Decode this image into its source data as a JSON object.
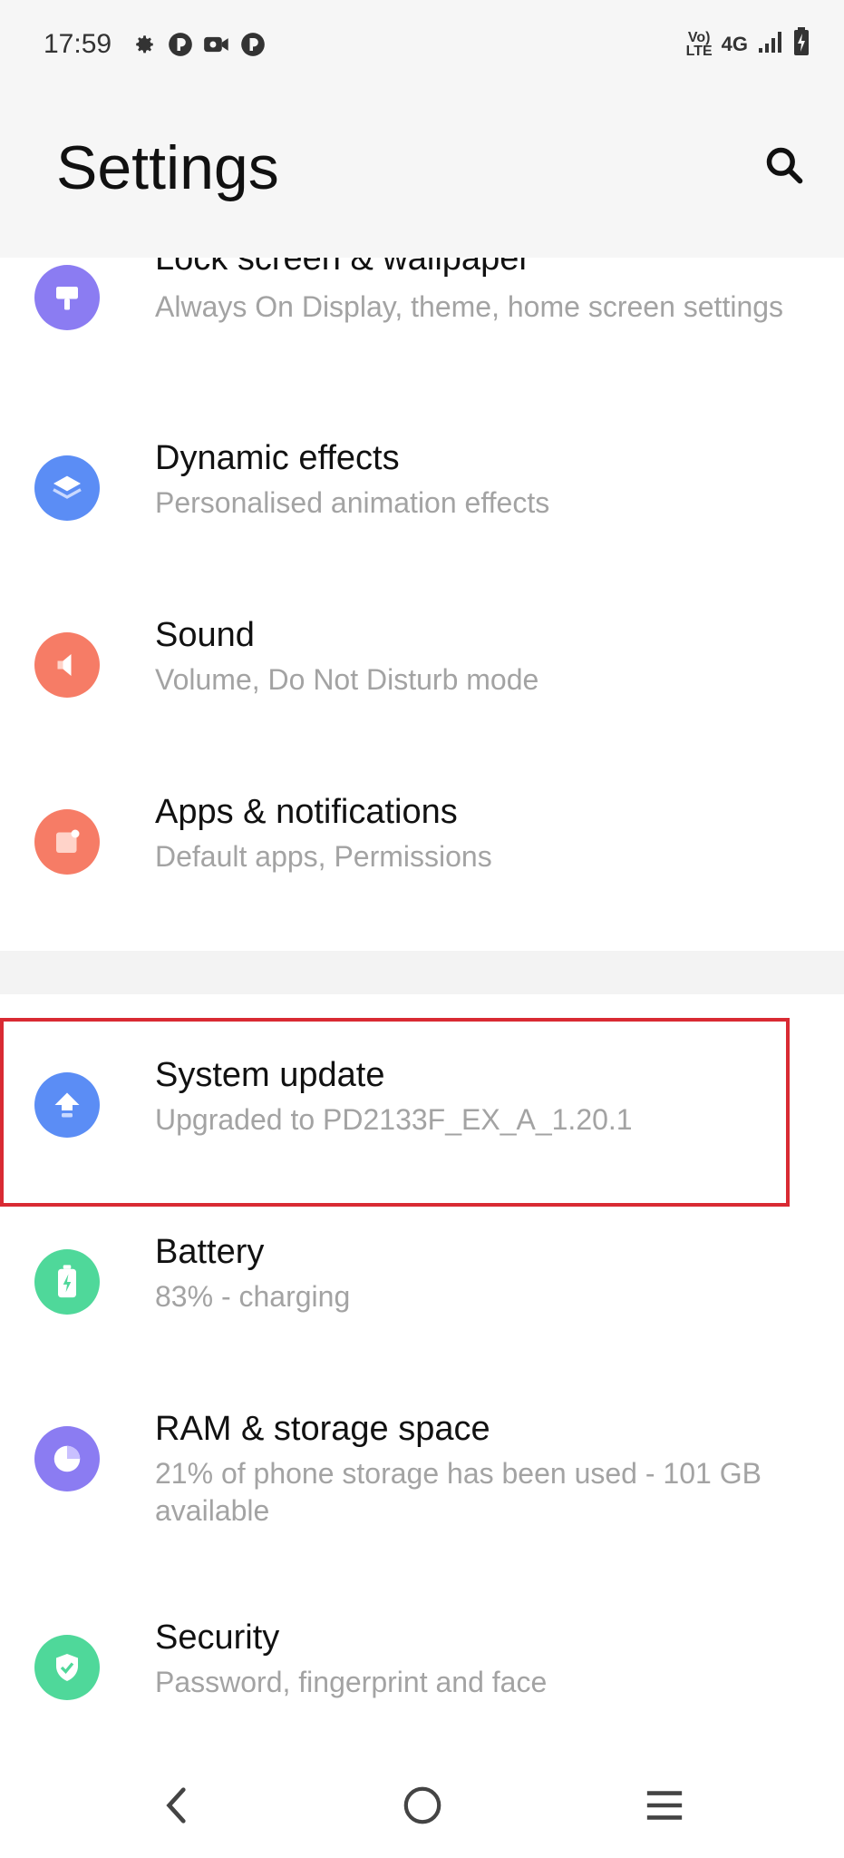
{
  "status_bar": {
    "time": "17:59",
    "left_icons": [
      "gear-icon",
      "app-icon",
      "video-icon",
      "app-icon"
    ],
    "lte_top": "Vo)",
    "lte_bottom": "LTE",
    "network": "4G",
    "right_icons": [
      "signal-icon",
      "battery-charging-icon"
    ]
  },
  "header": {
    "title": "Settings",
    "search_icon": "search-icon"
  },
  "settings": {
    "lock_screen": {
      "title": "Lock screen & wallpaper",
      "subtitle": "Always On Display, theme, home screen settings",
      "icon": "lock-screen-icon",
      "color": "#8b7cf2"
    },
    "dynamic_effects": {
      "title": "Dynamic effects",
      "subtitle": "Personalised animation effects",
      "icon": "layers-icon",
      "color": "#5b8df5"
    },
    "sound": {
      "title": "Sound",
      "subtitle": "Volume, Do Not Disturb mode",
      "icon": "speaker-icon",
      "color": "#f67c66"
    },
    "apps": {
      "title": "Apps & notifications",
      "subtitle": "Default apps, Permissions",
      "icon": "apps-icon",
      "color": "#f67c66"
    },
    "system_update": {
      "title": "System update",
      "subtitle": "Upgraded to PD2133F_EX_A_1.20.1",
      "icon": "upload-arrow-icon",
      "color": "#5b8df5"
    },
    "battery": {
      "title": "Battery",
      "subtitle": "83% - charging",
      "icon": "battery-icon",
      "color": "#4fd89a"
    },
    "storage": {
      "title": "RAM & storage space",
      "subtitle": "21% of phone storage has been used - 101 GB available",
      "icon": "pie-chart-icon",
      "color": "#8b7cf2"
    },
    "security": {
      "title": "Security",
      "subtitle": "Password, fingerprint and face",
      "icon": "shield-icon",
      "color": "#4fd89a"
    }
  },
  "highlight_color": "#d92a33",
  "navbar": {
    "icons": [
      "back-icon",
      "home-icon",
      "menu-icon"
    ]
  }
}
